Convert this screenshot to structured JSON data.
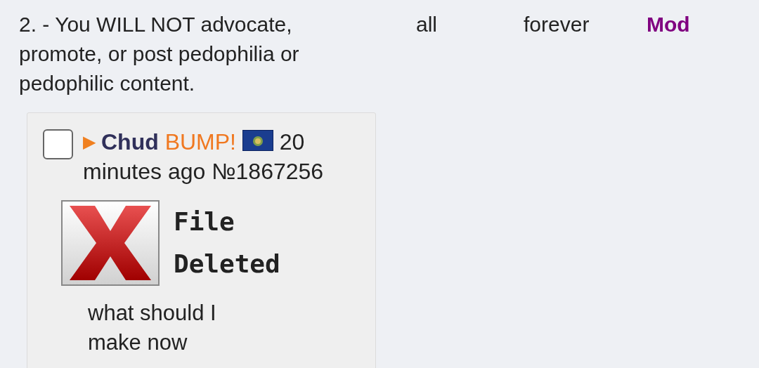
{
  "ban": {
    "reason": "2. - You WILL NOT advocate, promote, or post pedophilia or pedophilic content.",
    "board": "all",
    "expires": "forever",
    "by": "Mod"
  },
  "post": {
    "checked": false,
    "arrow": "▶",
    "name": "Chud",
    "subject": "BUMP!",
    "time": [
      "20",
      "minutes ago"
    ],
    "number": "№1867256",
    "file": {
      "kind": "deleted",
      "line_1": "File",
      "line_2": "Deleted"
    },
    "message": "what should I make now"
  }
}
